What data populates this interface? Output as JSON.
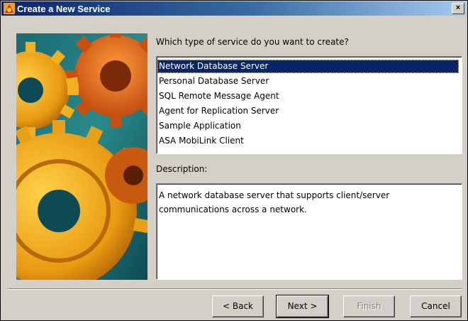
{
  "window": {
    "title": "Create a New Service",
    "close_label": "×"
  },
  "main": {
    "question": "Which type of service do you want to create?",
    "description_label": "Description:",
    "description_text": "A network database server that supports client/server communications across a network."
  },
  "service_list": {
    "items": [
      {
        "label": "Network Database Server",
        "selected": true
      },
      {
        "label": "Personal Database Server",
        "selected": false
      },
      {
        "label": "SQL Remote Message Agent",
        "selected": false
      },
      {
        "label": "Agent for Replication Server",
        "selected": false
      },
      {
        "label": "Sample Application",
        "selected": false
      },
      {
        "label": "ASA MobiLink Client",
        "selected": false
      }
    ]
  },
  "buttons": {
    "back": "< Back",
    "next": "Next >",
    "finish": "Finish",
    "cancel": "Cancel"
  },
  "colors": {
    "title_bar": "#0a246a",
    "selection": "#0a246a",
    "face": "#d4d0c8"
  }
}
